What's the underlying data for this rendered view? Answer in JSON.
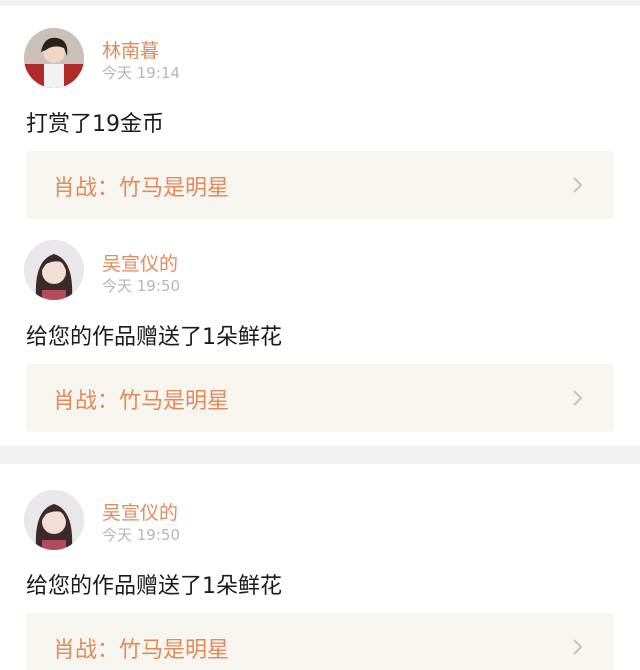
{
  "items": [
    {
      "user_name": "林南暮",
      "time": "今天 19:14",
      "message": "打赏了19金币",
      "card_title": "肖战：竹马是明星"
    },
    {
      "user_name": "吴宣仪的",
      "time": "今天 19:50",
      "message": "给您的作品赠送了1朵鲜花",
      "card_title": "肖战：竹马是明星"
    },
    {
      "user_name": "吴宣仪的",
      "time": "今天 19:50",
      "message": "给您的作品赠送了1朵鲜花",
      "card_title": "肖战：竹马是明星"
    }
  ],
  "colors": {
    "accent": "#e38a5a",
    "time_gray": "#b6b6b6",
    "card_bg": "#f6f5f0",
    "divider": "#f2f2f2",
    "text": "#1b1b1b"
  },
  "icons": {
    "chevron": "chevron-right-icon"
  }
}
